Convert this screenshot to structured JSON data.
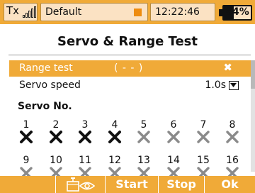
{
  "statusbar": {
    "tx_label": "Tx",
    "model_name": "Default",
    "clock": "12:22:46",
    "battery_percent": "64%",
    "battery_level": 0.64,
    "signal_bars": 5
  },
  "page": {
    "title": "Servo & Range Test"
  },
  "range_test": {
    "label": "Range test",
    "value": "( - - )"
  },
  "servo_speed": {
    "label": "Servo speed",
    "value": "1.0s"
  },
  "servo_section": {
    "heading": "Servo No.",
    "servos": [
      {
        "number": "1",
        "state": "active"
      },
      {
        "number": "2",
        "state": "active"
      },
      {
        "number": "3",
        "state": "active"
      },
      {
        "number": "4",
        "state": "active"
      },
      {
        "number": "5",
        "state": "inactive"
      },
      {
        "number": "6",
        "state": "inactive"
      },
      {
        "number": "7",
        "state": "inactive"
      },
      {
        "number": "8",
        "state": "inactive"
      },
      {
        "number": "9",
        "state": "inactive"
      },
      {
        "number": "10",
        "state": "inactive"
      },
      {
        "number": "11",
        "state": "inactive"
      },
      {
        "number": "12",
        "state": "inactive"
      },
      {
        "number": "13",
        "state": "inactive"
      },
      {
        "number": "14",
        "state": "inactive"
      },
      {
        "number": "15",
        "state": "inactive"
      },
      {
        "number": "16",
        "state": "inactive"
      }
    ]
  },
  "softkeys": {
    "view_icon": "transmitter-eye-icon",
    "start": "Start",
    "stop": "Stop",
    "ok": "Ok"
  },
  "colors": {
    "accent": "#f0aa38",
    "status_box": "#fbe2c3",
    "indicator": "#ee8c10",
    "active_mark": "#111111",
    "inactive_mark": "#8a8a8a"
  }
}
